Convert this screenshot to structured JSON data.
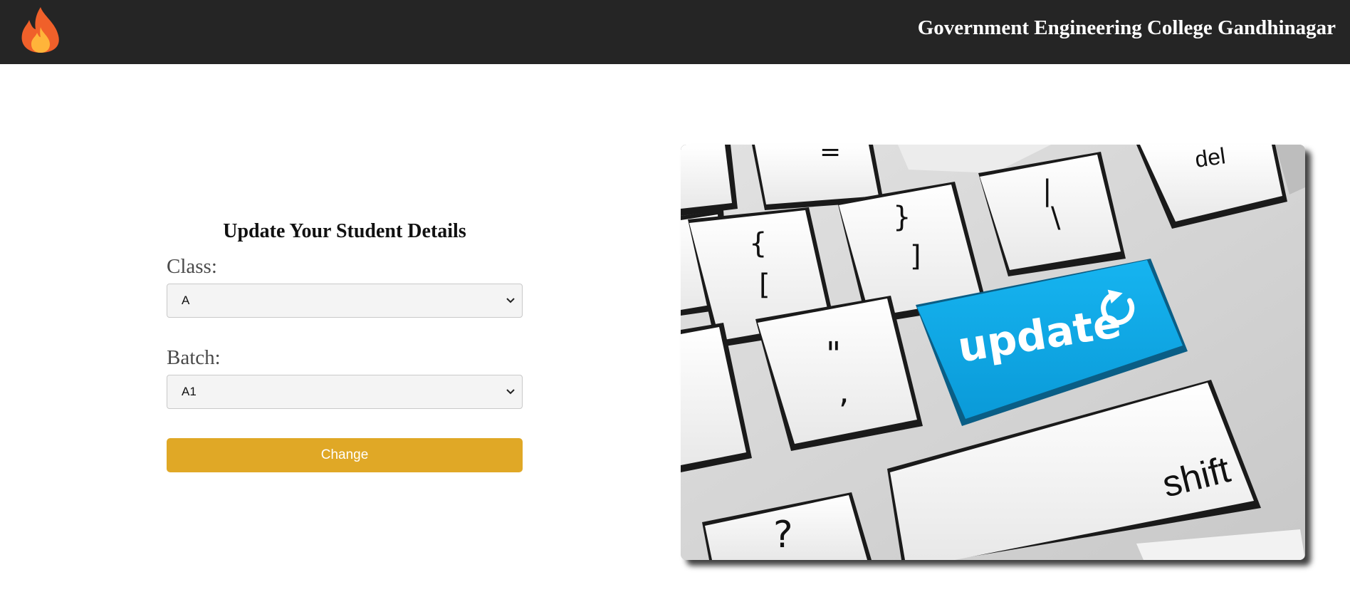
{
  "header": {
    "logo_icon": "fire-icon",
    "title": "Government Engineering College Gandhinagar",
    "background": "#252525"
  },
  "form": {
    "title": "Update Your Student Details",
    "class_label": "Class:",
    "class_value": "A",
    "batch_label": "Batch:",
    "batch_value": "A1",
    "submit_label": "Change",
    "submit_color": "#e0a826"
  },
  "hero_image": {
    "key_labels": {
      "equals": "=",
      "brace": "}",
      "bracket_close": "]",
      "brace_open": "{",
      "bracket_open": "[",
      "pipe": "|",
      "backslash": "\\",
      "del": "del",
      "update": "update",
      "quote": "\"",
      "comma": ",",
      "question": "?",
      "shift": "shift"
    },
    "update_key_color": "#0aaae8",
    "refresh_icon": "refresh-icon"
  }
}
